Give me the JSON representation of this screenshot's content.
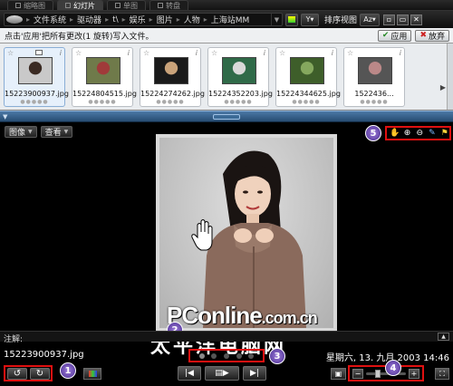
{
  "view_tabs": [
    {
      "label": "缩略图",
      "active": false
    },
    {
      "label": "幻灯片",
      "active": true
    },
    {
      "label": "单图",
      "active": false
    },
    {
      "label": "转盘",
      "active": false
    }
  ],
  "breadcrumb": [
    {
      "label": "文件系统"
    },
    {
      "label": "驱动器"
    },
    {
      "label": "t\\"
    },
    {
      "label": "娱乐"
    },
    {
      "label": "图片"
    },
    {
      "label": "人物"
    },
    {
      "label": "上海站MM"
    }
  ],
  "toolbar": {
    "filter_label": "Y",
    "sort_label": "排序视图",
    "az_label": "Az",
    "win_buttons": [
      "▫",
      "▭",
      "✕"
    ]
  },
  "infobar": {
    "message": "点击'应用'把所有更改(1 旋转)写入文件。",
    "apply_label": "应用",
    "discard_label": "放弃"
  },
  "thumbnails": [
    {
      "filename": "15223900937.jpg",
      "selected": true,
      "colors": [
        "#c9c9c9",
        "#3a2a22"
      ]
    },
    {
      "filename": "15224804515.jpg",
      "selected": false,
      "colors": [
        "#6f7a4a",
        "#a03a3a"
      ]
    },
    {
      "filename": "15224274262.jpg",
      "selected": false,
      "colors": [
        "#1a1a1a",
        "#caa37a"
      ]
    },
    {
      "filename": "15224352203.jpg",
      "selected": false,
      "colors": [
        "#2f6a48",
        "#d9d9d9"
      ]
    },
    {
      "filename": "15224344625.jpg",
      "selected": false,
      "colors": [
        "#3e5e2a",
        "#85a85e"
      ]
    },
    {
      "filename": "1522436...",
      "selected": false,
      "colors": [
        "#555",
        "#b88"
      ]
    }
  ],
  "rating_dots": "●●●●●",
  "viewer": {
    "menu": [
      {
        "label": "图像"
      },
      {
        "label": "查看"
      }
    ],
    "notes_label": "注解:",
    "filename": "15223900937.jpg",
    "datetime": "星期六, 13. 九月 2003 14:46",
    "page_dots": 5,
    "active_dot": 0
  },
  "callouts": [
    "1",
    "2",
    "3",
    "4",
    "5"
  ],
  "watermark": {
    "en_main": "PConline",
    "en_suffix": ".com.cn",
    "cn": "太平洋电脑网"
  },
  "tools": [
    "hand-icon",
    "zoom-in-icon",
    "zoom-out-icon",
    "pen-icon",
    "flag-icon"
  ],
  "zoom_level": 0.25,
  "colors": {
    "highlight": "#e01010",
    "callout": "#6a4ab8",
    "splitter": "#3b648e"
  }
}
